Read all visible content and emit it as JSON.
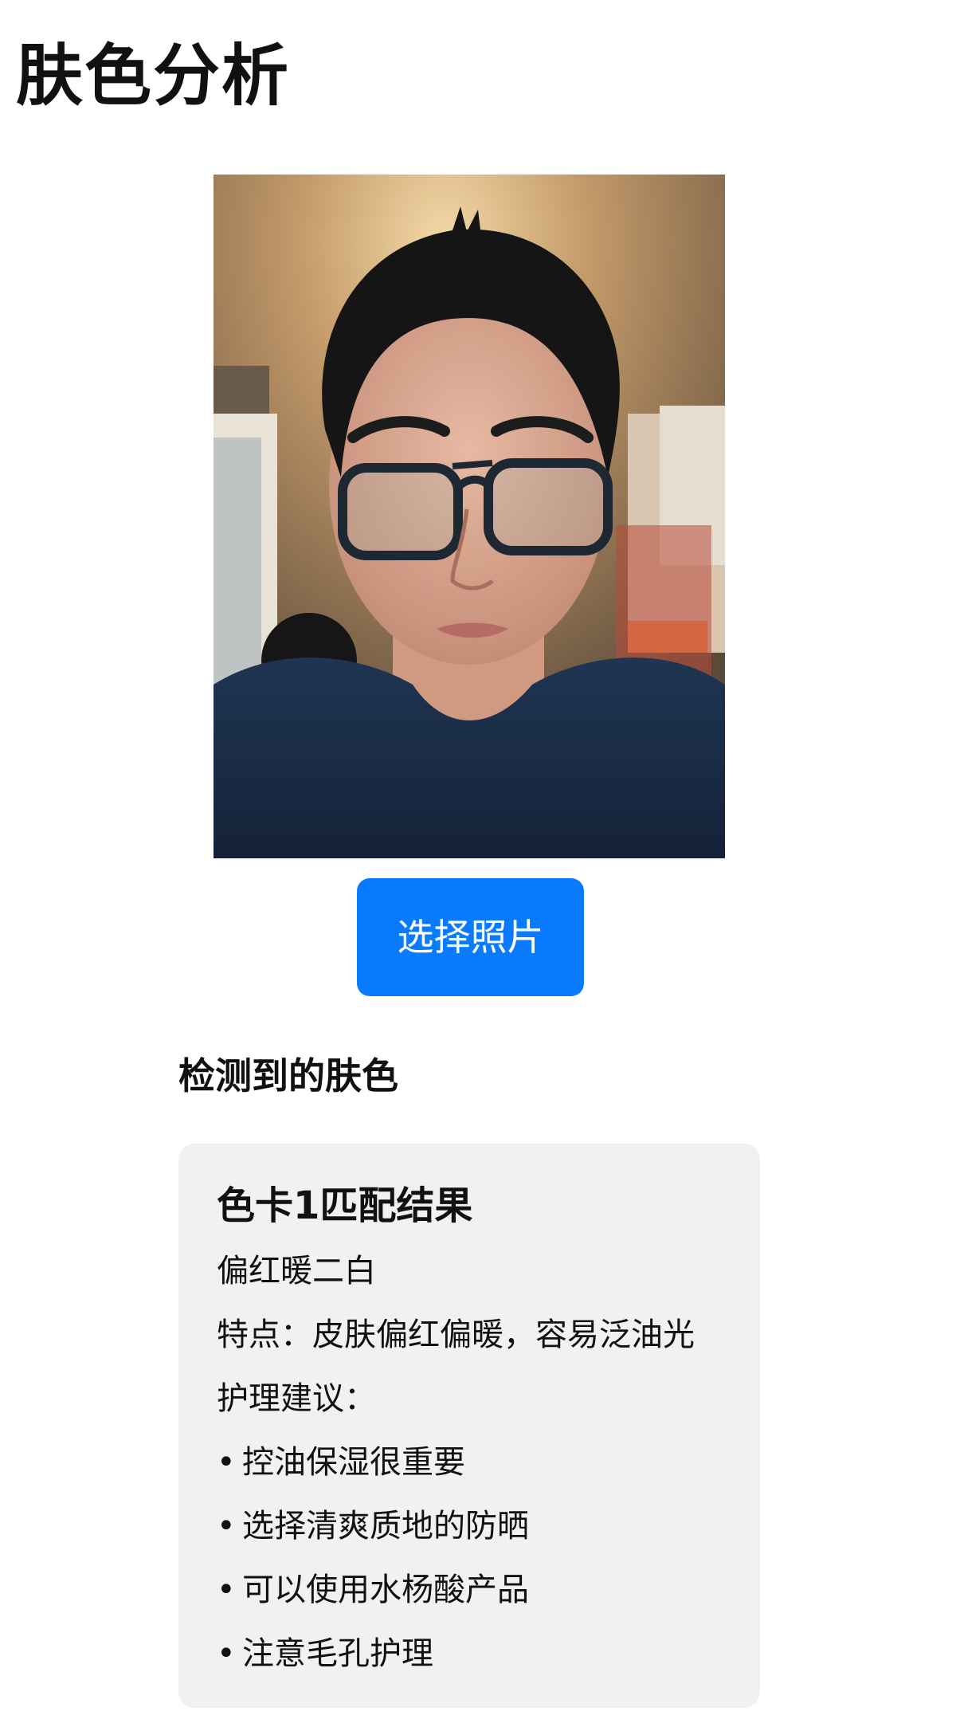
{
  "page": {
    "title": "肤色分析"
  },
  "photo": {
    "alt": "selfie"
  },
  "actions": {
    "select_photo_label": "选择照片"
  },
  "result": {
    "section_heading": "检测到的肤色",
    "card_title": "色卡1匹配结果",
    "tone_name": "偏红暖二白",
    "features": "特点：皮肤偏红偏暖，容易泛油光",
    "care_heading": "护理建议：",
    "bullet": "•",
    "tips": [
      "控油保湿很重要",
      "选择清爽质地的防晒",
      "可以使用水杨酸产品",
      "注意毛孔护理"
    ]
  },
  "colors": {
    "button_bg": "#0a7bff",
    "button_text": "#ffffff",
    "card_bg": "#f1f1f1",
    "text": "#111111"
  }
}
